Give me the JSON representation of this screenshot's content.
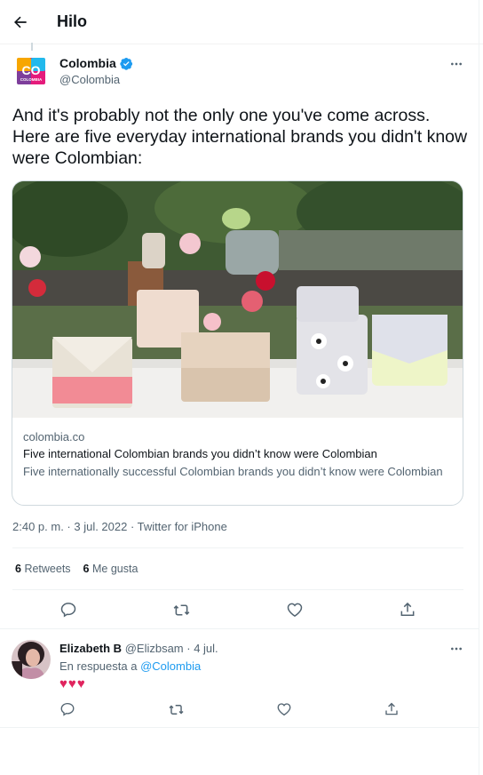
{
  "header": {
    "title": "Hilo"
  },
  "tweet": {
    "author": {
      "name": "Colombia",
      "handle": "@Colombia",
      "verified": true,
      "avatar_text": "CO",
      "avatar_subtext": "COLOMBIA"
    },
    "text": "And it's probably not the only one you've come across. Here are five everyday international brands you didn't know were Colombian:",
    "card": {
      "domain": "colombia.co",
      "title": "Five international Colombian brands you didn’t know were Colombian",
      "description": "Five internationally successful Colombian brands you didn’t know were Colombian"
    },
    "timestamp": "2:40 p. m. · 3 jul. 2022 · Twitter for iPhone",
    "stats": {
      "retweets_count": "6",
      "retweets_label": "Retweets",
      "likes_count": "6",
      "likes_label": "Me gusta"
    }
  },
  "reply": {
    "name": "Elizabeth B",
    "handle": "@Elizbsam",
    "date": "· 4 jul.",
    "in_reply_prefix": "En respuesta a",
    "in_reply_handle": "@Colombia",
    "text": "♥♥♥"
  },
  "colors": {
    "link": "#1d9bf0",
    "verified": "#1d9bf0",
    "heart": "#e0245e",
    "muted": "#536471"
  },
  "icons": [
    "back-arrow-icon",
    "verified-badge-icon",
    "more-icon",
    "reply-icon",
    "retweet-icon",
    "like-icon",
    "share-icon"
  ]
}
